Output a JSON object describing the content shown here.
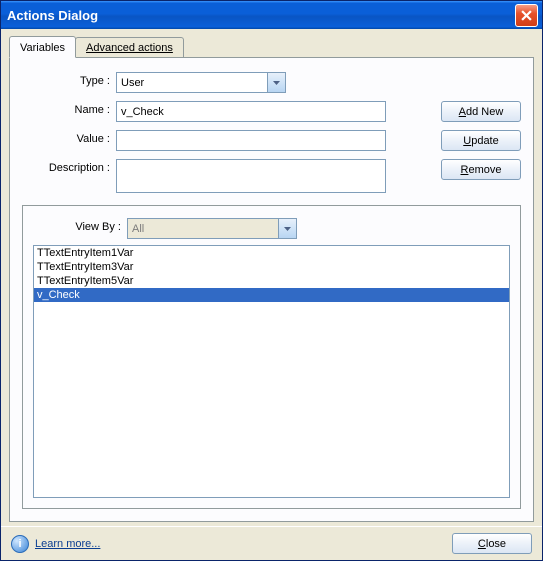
{
  "window": {
    "title": "Actions Dialog"
  },
  "tabs": {
    "variables": "Variables",
    "advanced": "Advanced actions",
    "active": "variables"
  },
  "form": {
    "type_label": "Type :",
    "type_value": "User",
    "name_label": "Name :",
    "name_value": "v_Check",
    "value_label": "Value :",
    "value_value": "",
    "desc_label": "Description :",
    "desc_value": ""
  },
  "buttons": {
    "add_new_pre": "",
    "add_new_ul": "A",
    "add_new_post": "dd New",
    "update_pre": "",
    "update_ul": "U",
    "update_post": "pdate",
    "remove_pre": "",
    "remove_ul": "R",
    "remove_post": "emove",
    "close_pre": "",
    "close_ul": "C",
    "close_post": "lose"
  },
  "viewby": {
    "label": "View By :",
    "value": "All"
  },
  "list": {
    "items": [
      {
        "label": "TTextEntryItem1Var",
        "selected": false
      },
      {
        "label": "TTextEntryItem3Var",
        "selected": false
      },
      {
        "label": "TTextEntryItem5Var",
        "selected": false
      },
      {
        "label": "v_Check",
        "selected": true
      }
    ]
  },
  "footer": {
    "learn": "Learn more..."
  }
}
